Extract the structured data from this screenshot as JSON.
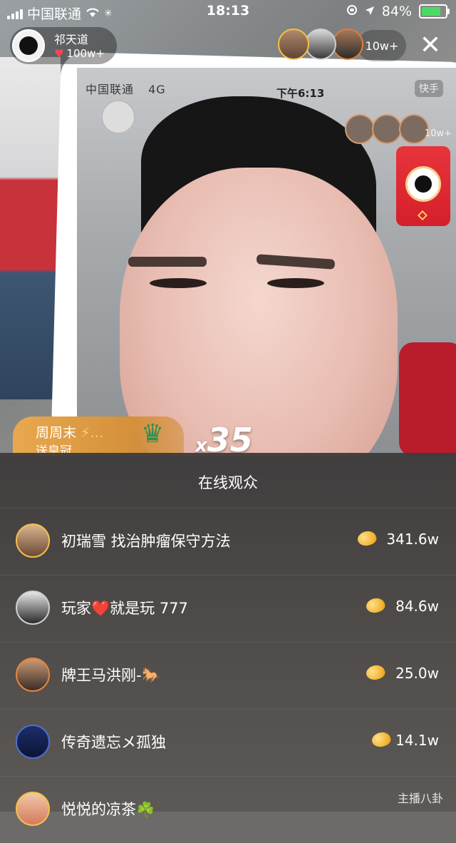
{
  "status_bar": {
    "carrier": "中国联通",
    "time": "18:13",
    "battery": "84%",
    "battery_level": 0.84
  },
  "stream_background": {
    "carrier": "中国联通",
    "network": "4G",
    "time": "下午6:13",
    "app_brand": "快手",
    "viewer_count": "10w+"
  },
  "anchor": {
    "name": "祁天道",
    "likes": "100w+"
  },
  "top_bar": {
    "viewer_count": "10w+",
    "close_icon": "close-icon"
  },
  "gift_banner": {
    "sender": "周周末",
    "action": "送皇冠",
    "combo_prefix": "x",
    "combo_count": "35"
  },
  "viewer_panel": {
    "title": "在线观众",
    "viewers": [
      {
        "name": "初瑞雪 找治肿瘤保守方法",
        "value": "341.6w",
        "ring": "gold"
      },
      {
        "name": "玩家❤️就是玩 777",
        "value": "84.6w",
        "ring": "grey"
      },
      {
        "name": "牌王马洪刚-🐎",
        "value": "25.0w",
        "ring": "orange"
      },
      {
        "name": "传奇遗忘メ孤独",
        "value": "14.1w",
        "ring": "blue"
      },
      {
        "name": "悦悦的凉茶☘️",
        "value": "",
        "ring": "gold"
      }
    ]
  },
  "watermark": "主播八卦"
}
